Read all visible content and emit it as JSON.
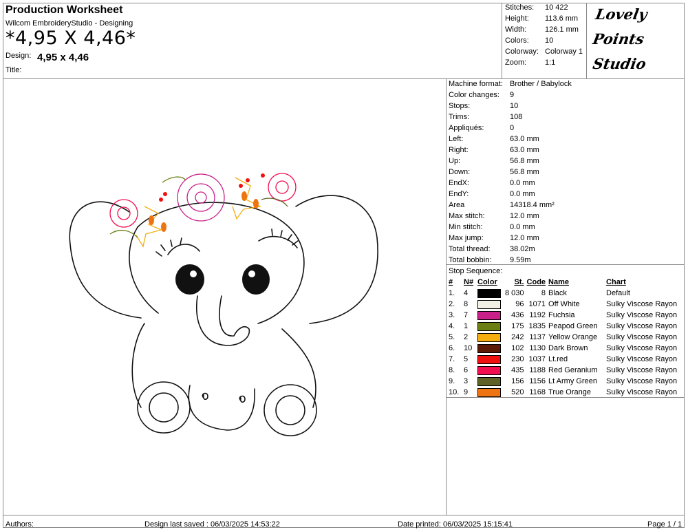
{
  "header": {
    "title": "Production Worksheet",
    "subtitle": "Wilcom EmbroideryStudio - Designing",
    "big_code": "*4,95 X 4,46*",
    "design_label": "Design:",
    "design_value": "4,95 x 4,46",
    "title_label": "Title:"
  },
  "summary": [
    {
      "key": "Stitches:",
      "value": "10 422"
    },
    {
      "key": "Height:",
      "value": "113.6 mm"
    },
    {
      "key": "Width:",
      "value": "126.1 mm"
    },
    {
      "key": "Colors:",
      "value": "10"
    },
    {
      "key": "Colorway:",
      "value": "Colorway 1"
    },
    {
      "key": "Zoom:",
      "value": "1:1"
    }
  ],
  "logo": {
    "line1": "Lovely",
    "line2": "Points",
    "line3": "Studio"
  },
  "machine": [
    {
      "key": "Machine format:",
      "value": "Brother / Babylock"
    },
    {
      "key": "Color changes:",
      "value": "9"
    },
    {
      "key": "Stops:",
      "value": "10"
    },
    {
      "key": "Trims:",
      "value": "108"
    },
    {
      "key": "Appliqués:",
      "value": "0"
    },
    {
      "key": "Left:",
      "value": "63.0 mm"
    },
    {
      "key": "Right:",
      "value": "63.0 mm"
    },
    {
      "key": "Up:",
      "value": "56.8 mm"
    },
    {
      "key": "Down:",
      "value": "56.8 mm"
    },
    {
      "key": "EndX:",
      "value": "0.0 mm"
    },
    {
      "key": "EndY:",
      "value": "0.0 mm"
    },
    {
      "key": "Area",
      "value": "14318.4 mm²"
    },
    {
      "key": "Max stitch:",
      "value": "12.0 mm"
    },
    {
      "key": "Min stitch:",
      "value": "0.0 mm"
    },
    {
      "key": "Max jump:",
      "value": "12.0 mm"
    },
    {
      "key": "Total thread:",
      "value": "38.02m"
    },
    {
      "key": "Total bobbin:",
      "value": "9.59m"
    }
  ],
  "stop_sequence_label": "Stop Sequence:",
  "table_headers": {
    "idx": "#",
    "n": "N#",
    "color": "Color",
    "st": "St.",
    "code": "Code",
    "name": "Name",
    "chart": "Chart"
  },
  "stops": [
    {
      "idx": "1.",
      "n": "4",
      "color": "#000000",
      "st": "8 030",
      "code": "8",
      "name": "Black",
      "chart": "Default"
    },
    {
      "idx": "2.",
      "n": "8",
      "color": "#f2f0e4",
      "st": "96",
      "code": "1071",
      "name": "Off White",
      "chart": "Sulky Viscose Rayon"
    },
    {
      "idx": "3.",
      "n": "7",
      "color": "#c9208a",
      "st": "436",
      "code": "1192",
      "name": "Fuchsia",
      "chart": "Sulky Viscose Rayon"
    },
    {
      "idx": "4.",
      "n": "1",
      "color": "#6c7f12",
      "st": "175",
      "code": "1835",
      "name": "Peapod Green",
      "chart": "Sulky Viscose Rayon"
    },
    {
      "idx": "5.",
      "n": "2",
      "color": "#f4ae10",
      "st": "242",
      "code": "1137",
      "name": "Yellow Orange",
      "chart": "Sulky Viscose Rayon"
    },
    {
      "idx": "6.",
      "n": "10",
      "color": "#5a1a06",
      "st": "102",
      "code": "1130",
      "name": "Dark Brown",
      "chart": "Sulky Viscose Rayon"
    },
    {
      "idx": "7.",
      "n": "5",
      "color": "#ef1010",
      "st": "230",
      "code": "1037",
      "name": "Lt.red",
      "chart": "Sulky Viscose Rayon"
    },
    {
      "idx": "8.",
      "n": "6",
      "color": "#f20f50",
      "st": "435",
      "code": "1188",
      "name": "Red Geranium",
      "chart": "Sulky Viscose Rayon"
    },
    {
      "idx": "9.",
      "n": "3",
      "color": "#5f6226",
      "st": "156",
      "code": "1156",
      "name": "Lt Army Green",
      "chart": "Sulky Viscose Rayon"
    },
    {
      "idx": "10.",
      "n": "9",
      "color": "#ee7412",
      "st": "520",
      "code": "1168",
      "name": "True Orange",
      "chart": "Sulky Viscose Rayon"
    }
  ],
  "footer": {
    "authors": "Authors:",
    "saved": "Design last saved : 06/03/2025 14:53:22",
    "printed": "Date printed: 06/03/2025 15:15:41",
    "page": "Page 1 / 1"
  }
}
